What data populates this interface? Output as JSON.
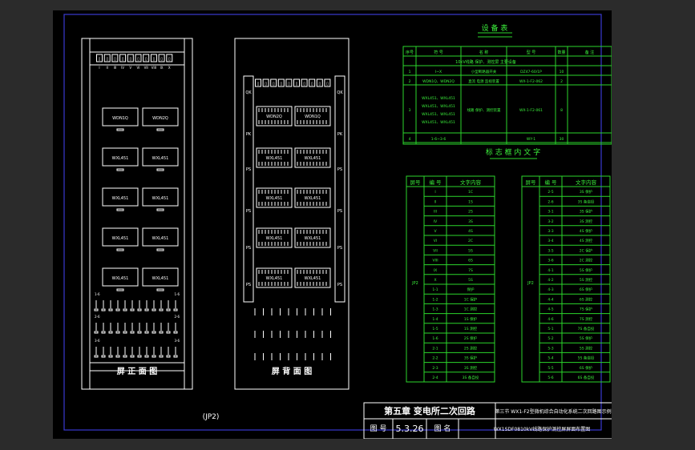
{
  "front_panel": {
    "title": "屏 正 面 图",
    "top_labels": [
      "I",
      "II",
      "III",
      "IV",
      "V",
      "VI",
      "VII",
      "VIII",
      "IX",
      "X"
    ],
    "devices": [
      [
        "WDN1Q",
        "WDN2Q"
      ],
      [
        "WXL451",
        "WXL451"
      ],
      [
        "WXL451",
        "WXL451"
      ],
      [
        "WXL451",
        "WXL451"
      ],
      [
        "WXL451",
        "WXL451"
      ]
    ],
    "terminal_rows": [
      "1-6",
      "2-6",
      "3-6"
    ]
  },
  "rear_panel": {
    "title": "屏 背 面 图",
    "side_labels_left": [
      "QK",
      "PK",
      "PS",
      "PS",
      "PS",
      "PS"
    ],
    "side_labels_right": [
      "QK",
      "PK",
      "PS",
      "PS",
      "PS",
      "PS"
    ],
    "devices": [
      [
        "WDN2Q",
        "WDN1Q"
      ],
      [
        "WXL451",
        "WXL451"
      ],
      [
        "WXL451",
        "WXL451"
      ],
      [
        "WXL451",
        "WXL451"
      ],
      [
        "WXL451",
        "WXL451"
      ]
    ]
  },
  "device_table": {
    "title": "设 备 表",
    "headers": [
      "序号",
      "符 号",
      "名 称",
      "型 号",
      "数量",
      "备 注"
    ],
    "section": "10kV线路 保护、测控屏 主要设备",
    "rows": [
      [
        "1",
        "I~X",
        "小型断路器开关",
        "DZ47-60/1P",
        "10",
        ""
      ],
      [
        "2",
        "WDN1Q、WDN2Q",
        "直流 电源 监视装置",
        "WX-1-F2-062",
        "2",
        ""
      ],
      [
        "3",
        "WXL451、WXL451\nWXL451、WXL451\nWXL451、WXL451\nWXL451、WXL451",
        "线路 保护、测控装置",
        "WX-1-F2-061",
        "8",
        ""
      ],
      [
        "4",
        "1-6~3-6",
        "",
        "WY-1",
        "30",
        ""
      ]
    ]
  },
  "label_table": {
    "title": "标 志 框 内 文 字",
    "headers": [
      "屏号",
      "编 号",
      "文字内容"
    ],
    "panel": "JP2",
    "left_rows": [
      [
        "I",
        "1C"
      ],
      [
        "II",
        "1S"
      ],
      [
        "III",
        "2S"
      ],
      [
        "IV",
        "3S"
      ],
      [
        "V",
        "4S"
      ],
      [
        "VI",
        "2C"
      ],
      [
        "VII",
        "5S"
      ],
      [
        "VIII",
        "6S"
      ],
      [
        "IX",
        "7S"
      ],
      [
        "X",
        "5S"
      ],
      [
        "1-1",
        "保护"
      ],
      [
        "1-2",
        "1C 保护"
      ],
      [
        "1-3",
        "1C 测控"
      ],
      [
        "1-4",
        "1S 保护"
      ],
      [
        "1-5",
        "1S 测控"
      ],
      [
        "1-6",
        "2S 保护"
      ],
      [
        "2-1",
        "2S 测控"
      ],
      [
        "2-2",
        "3S 保护"
      ],
      [
        "2-3",
        "3S 测控"
      ],
      [
        "2-4",
        "3S 备自投"
      ]
    ],
    "right_rows": [
      [
        "2-5",
        "3S 保护"
      ],
      [
        "2-6",
        "3S 备自投"
      ],
      [
        "3-1",
        "3S 保护"
      ],
      [
        "3-2",
        "3S 测控"
      ],
      [
        "3-3",
        "4S 保护"
      ],
      [
        "3-4",
        "4S 测控"
      ],
      [
        "3-5",
        "2C 保护"
      ],
      [
        "3-6",
        "2C 测控"
      ],
      [
        "4-1",
        "5S 保护"
      ],
      [
        "4-2",
        "5S 测控"
      ],
      [
        "4-3",
        "6S 保护"
      ],
      [
        "4-4",
        "6S 测控"
      ],
      [
        "4-5",
        "7S 保护"
      ],
      [
        "4-6",
        "7S 测控"
      ],
      [
        "5-1",
        "7S 备自投"
      ],
      [
        "5-2",
        "5S 保护"
      ],
      [
        "5-3",
        "5S 测控"
      ],
      [
        "5-4",
        "5S 备自投"
      ],
      [
        "5-5",
        "6S 保护"
      ],
      [
        "5-6",
        "6S 备自投"
      ]
    ]
  },
  "drawing_label": "(JP2)",
  "title_block": {
    "chapter": "第五章 变电所二次回路",
    "subtitle": "第三节 WX1-F2型微机综合自动化系统二次回路图示例",
    "drawing_no_label": "图 号",
    "drawing_no": "5.3.26",
    "drawing_name_label": "图 名",
    "drawing_name": "WX1SDF0810kV线路保护测控屏屏面布置图"
  }
}
